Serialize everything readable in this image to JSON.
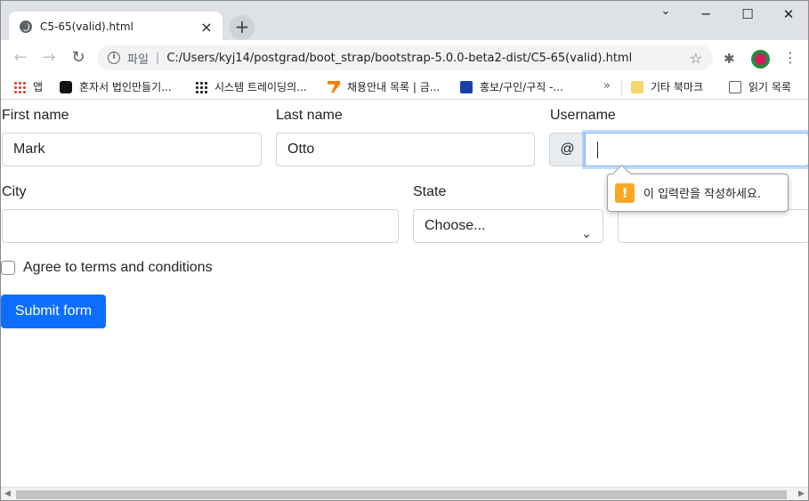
{
  "tab": {
    "title": "C5-65(valid).html",
    "close_icon": "×"
  },
  "window_controls": {
    "newtab": "+",
    "minimize": "─",
    "maximize": "☐",
    "close": "✕"
  },
  "toolbar": {
    "back": "←",
    "forward": "→",
    "reload": "↻",
    "scheme_label": "파일",
    "info_icon": "i",
    "separator": "|",
    "url": "C:/Users/kyj14/postgrad/boot_strap/bootstrap-5.0.0-beta2-dist/C5-65(valid).html",
    "star": "☆",
    "extensions": "✱",
    "menu": "⋮"
  },
  "bookmarks": {
    "items": [
      {
        "label": "앱",
        "icon": "apps-grid-icon"
      },
      {
        "label": "혼자서 법인만들기...",
        "icon": "dark-logo-icon"
      },
      {
        "label": "시스템 트레이딩의...",
        "icon": "dots-logo-icon"
      },
      {
        "label": "채용안내 목록 | 금...",
        "icon": "orange-logo-icon"
      },
      {
        "label": "홍보/구인/구직 -...",
        "icon": "blue-logo-icon"
      }
    ],
    "overflow": "»",
    "other": "기타 북마크",
    "reading_list": "읽기 목록"
  },
  "form": {
    "first_name_label": "First name",
    "first_name_value": "Mark",
    "last_name_label": "Last name",
    "last_name_value": "Otto",
    "username_label": "Username",
    "username_prefix": "@",
    "username_value": "",
    "city_label": "City",
    "city_value": "",
    "state_label": "State",
    "state_value": "Choose...",
    "state_arrow": "⌄",
    "zip_value": "",
    "agree_label": "Agree to terms and conditions",
    "submit_label": "Submit form"
  },
  "tooltip": {
    "icon": "!",
    "message": "이 입력란을 작성하세요."
  },
  "colors": {
    "primary": "#0d6efd",
    "warning": "#f9a825",
    "focus_border": "#86b7fe"
  }
}
